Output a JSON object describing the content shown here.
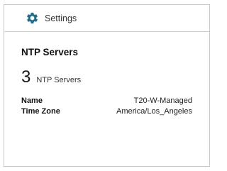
{
  "header": {
    "icon": "gear-icon",
    "title": "Settings",
    "icon_color": "#1d6f8f"
  },
  "ntp": {
    "section_title": "NTP Servers",
    "count": "3",
    "count_label": "NTP Servers",
    "details": [
      {
        "key": "Name",
        "value": "T20-W-Managed"
      },
      {
        "key": "Time Zone",
        "value": "America/Los_Angeles"
      }
    ]
  }
}
